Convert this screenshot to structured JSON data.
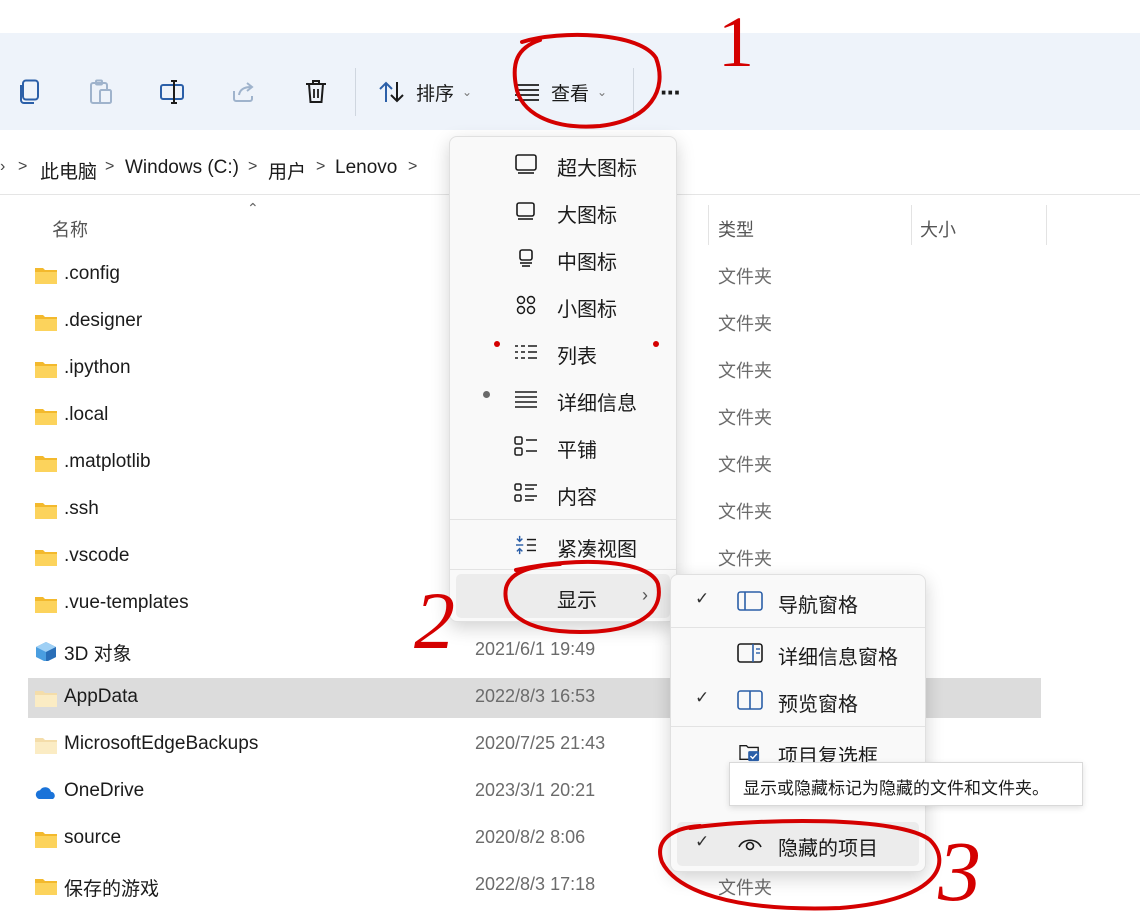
{
  "toolbar": {
    "sort_label": "排序",
    "view_label": "查看",
    "more_label": "···"
  },
  "breadcrumb": {
    "items": [
      "此电脑",
      "Windows (C:)",
      "用户",
      "Lenovo"
    ]
  },
  "columns": {
    "name": "名称",
    "type": "类型",
    "size": "大小"
  },
  "rows": [
    {
      "name": ".config",
      "date": "",
      "type": "文件夹",
      "icon": "folder-icon"
    },
    {
      "name": ".designer",
      "date": "",
      "type": "文件夹",
      "icon": "folder-icon"
    },
    {
      "name": ".ipython",
      "date": "",
      "type": "文件夹",
      "icon": "folder-icon"
    },
    {
      "name": ".local",
      "date": "",
      "type": "文件夹",
      "icon": "folder-icon"
    },
    {
      "name": ".matplotlib",
      "date": "",
      "type": "文件夹",
      "icon": "folder-icon"
    },
    {
      "name": ".ssh",
      "date": "",
      "type": "文件夹",
      "icon": "folder-icon"
    },
    {
      "name": ".vscode",
      "date": "",
      "type": "文件夹",
      "icon": "folder-icon"
    },
    {
      "name": ".vue-templates",
      "date": "",
      "type": "",
      "icon": "folder-icon"
    },
    {
      "name": "3D 对象",
      "date": "2021/6/1 19:49",
      "type": "",
      "icon": "3d-objects-icon"
    },
    {
      "name": "AppData",
      "date": "2022/8/3 16:53",
      "type": "",
      "icon": "folder-hidden-icon"
    },
    {
      "name": "MicrosoftEdgeBackups",
      "date": "2020/7/25 21:43",
      "type": "",
      "icon": "folder-hidden-icon"
    },
    {
      "name": "OneDrive",
      "date": "2023/3/1 20:21",
      "type": "",
      "icon": "onedrive-icon"
    },
    {
      "name": "source",
      "date": "2020/8/2 8:06",
      "type": "",
      "icon": "folder-icon"
    },
    {
      "name": "保存的游戏",
      "date": "2022/8/3 17:18",
      "type": "文件夹",
      "icon": "folder-icon"
    }
  ],
  "view_menu": {
    "items": [
      {
        "label": "超大图标",
        "icon": "extra-large-icons-icon"
      },
      {
        "label": "大图标",
        "icon": "large-icons-icon"
      },
      {
        "label": "中图标",
        "icon": "medium-icons-icon"
      },
      {
        "label": "小图标",
        "icon": "small-icons-icon"
      },
      {
        "label": "列表",
        "icon": "list-icon"
      },
      {
        "label": "详细信息",
        "icon": "details-icon",
        "selected": true
      },
      {
        "label": "平铺",
        "icon": "tiles-icon"
      },
      {
        "label": "内容",
        "icon": "content-icon"
      },
      {
        "label": "紧凑视图",
        "icon": "compact-view-icon"
      },
      {
        "label": "显示",
        "icon": "chevron-right-icon"
      }
    ]
  },
  "show_menu": {
    "items": [
      {
        "label": "导航窗格",
        "checked": true,
        "icon": "navigation-pane-icon"
      },
      {
        "label": "详细信息窗格",
        "checked": false,
        "icon": "details-pane-icon"
      },
      {
        "label": "预览窗格",
        "checked": true,
        "icon": "preview-pane-icon"
      },
      {
        "label": "项目复选框",
        "checked": false,
        "icon": "item-checkbox-icon"
      },
      {
        "label": "隐藏的项目",
        "checked": true,
        "icon": "eye-icon"
      }
    ]
  },
  "tooltip": {
    "text": "显示或隐藏标记为隐藏的文件和文件夹。"
  },
  "annotations": {
    "num1": "1",
    "num2": "2",
    "num3": "3",
    "color": "#d40000"
  }
}
